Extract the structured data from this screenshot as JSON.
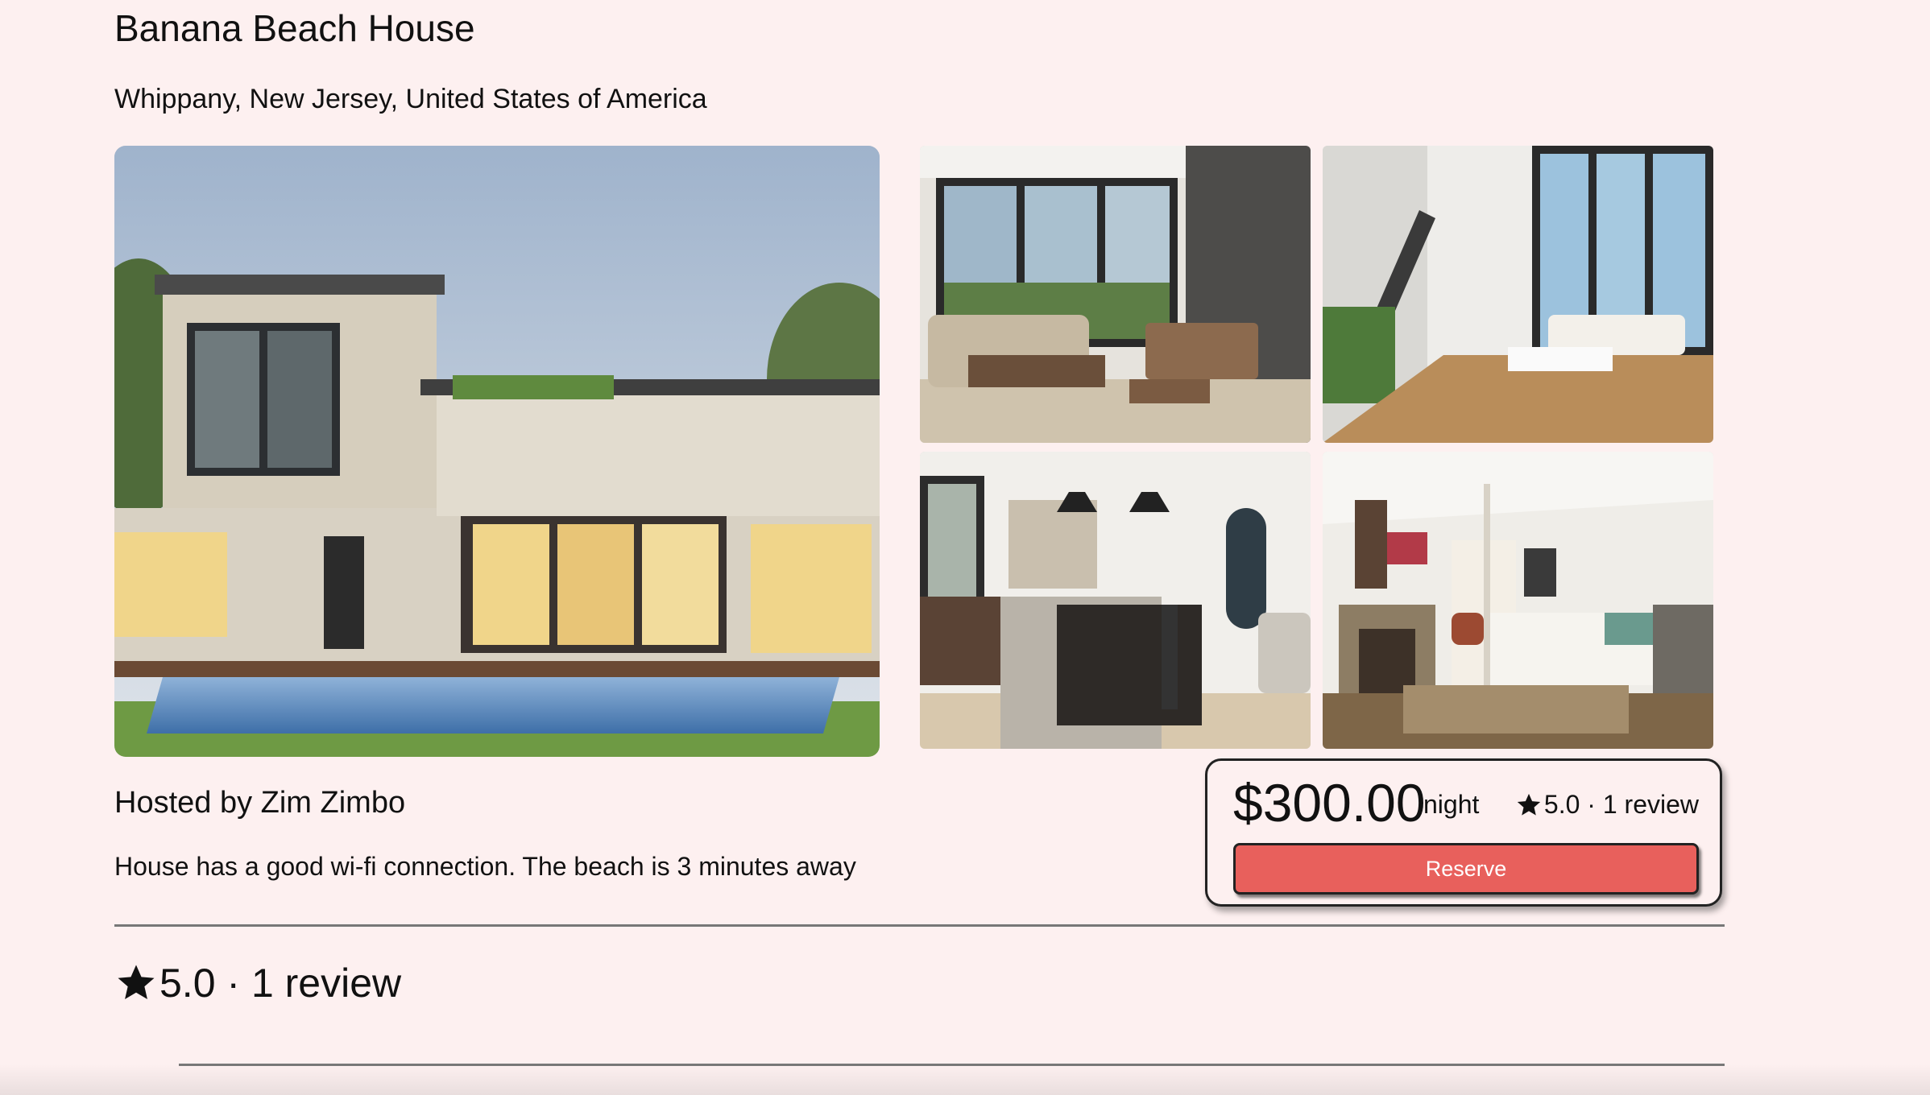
{
  "listing": {
    "title": "Banana Beach House",
    "location": "Whippany, New Jersey, United States of America",
    "host_line": "Hosted by Zim Zimbo",
    "description": "House has a good wi-fi connection. The beach is 3 minutes away"
  },
  "photos": {
    "main": "modern-house-exterior-with-pool",
    "thumbnails": [
      "living-room",
      "living-room-with-staircase",
      "kitchen",
      "bedroom"
    ]
  },
  "booking": {
    "price": "$300.00",
    "per_unit": "night",
    "rating": "5.0 · 1 review",
    "reserve_label": "Reserve"
  },
  "reviews": {
    "summary": "5.0 · 1 review"
  },
  "colors": {
    "background": "#fdf0f0",
    "reserve_button": "#e8605c",
    "divider": "#777777"
  }
}
